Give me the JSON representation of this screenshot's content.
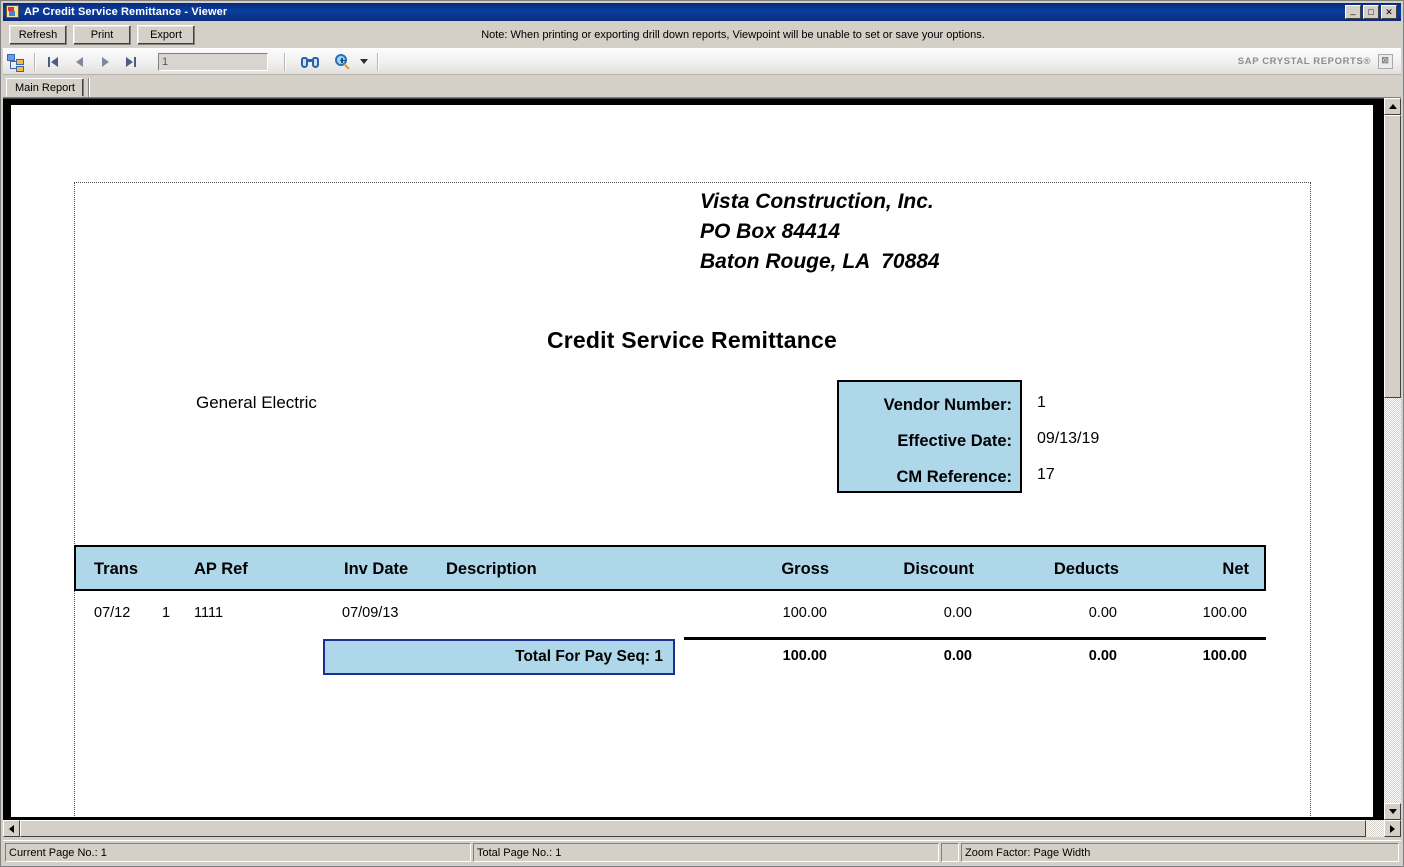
{
  "window": {
    "title": "AP Credit Service Remittance - Viewer",
    "icon": "document-icon",
    "minimize_label": "_",
    "maximize_label": "□",
    "close_label": "✕"
  },
  "toolbar": {
    "refresh_label": "Refresh",
    "print_label": "Print",
    "export_label": "Export",
    "note": "Note: When printing or exporting drill down reports, Viewpoint will be unable to set or save your options."
  },
  "crystal_toolbar": {
    "group_tree_icon": "tree-view-icon",
    "first_page_icon": "first-page-icon",
    "prev_page_icon": "previous-page-icon",
    "next_page_icon": "next-page-icon",
    "last_page_icon": "last-page-icon",
    "page_number_value": "1",
    "search_icon": "binoculars-search-icon",
    "zoom_icon": "zoom-magnifier-icon",
    "zoom_dropdown_icon": "chevron-down-icon",
    "brand": "SAP CRYSTAL REPORTS®",
    "brand_close_label": "⊠"
  },
  "tabs": {
    "main_report": "Main Report"
  },
  "report": {
    "company": "Vista Construction, Inc.\nPO Box 84414\nBaton Rouge, LA  70884",
    "title": "Credit Service Remittance",
    "vendor_name": "General Electric",
    "info_box": {
      "labels": [
        "Vendor Number:",
        "Effective Date:",
        "CM Reference:"
      ],
      "values": [
        "1",
        "09/13/19",
        "17"
      ]
    },
    "table": {
      "headers": [
        "Trans",
        "AP Ref",
        "Inv Date",
        "Description",
        "Gross",
        "Discount",
        "Deducts",
        "Net"
      ],
      "rows": [
        {
          "trans": "07/12",
          "seq": "1",
          "ap_ref": "1111",
          "inv_date": "07/09/13",
          "description": "",
          "gross": "100.00",
          "discount": "0.00",
          "deducts": "0.00",
          "net": "100.00"
        }
      ],
      "total": {
        "label": "Total For Pay Seq: 1",
        "gross": "100.00",
        "discount": "0.00",
        "deducts": "0.00",
        "net": "100.00"
      }
    }
  },
  "status": {
    "current_page": "Current Page No.: 1",
    "total_page": "Total Page No.: 1",
    "zoom_factor": "Zoom Factor: Page Width"
  },
  "colors": {
    "title_bar": "#0a3fa0",
    "header_fill": "#aed8ea",
    "total_box_border": "#1f2f8f",
    "chrome": "#d4d0c8"
  }
}
